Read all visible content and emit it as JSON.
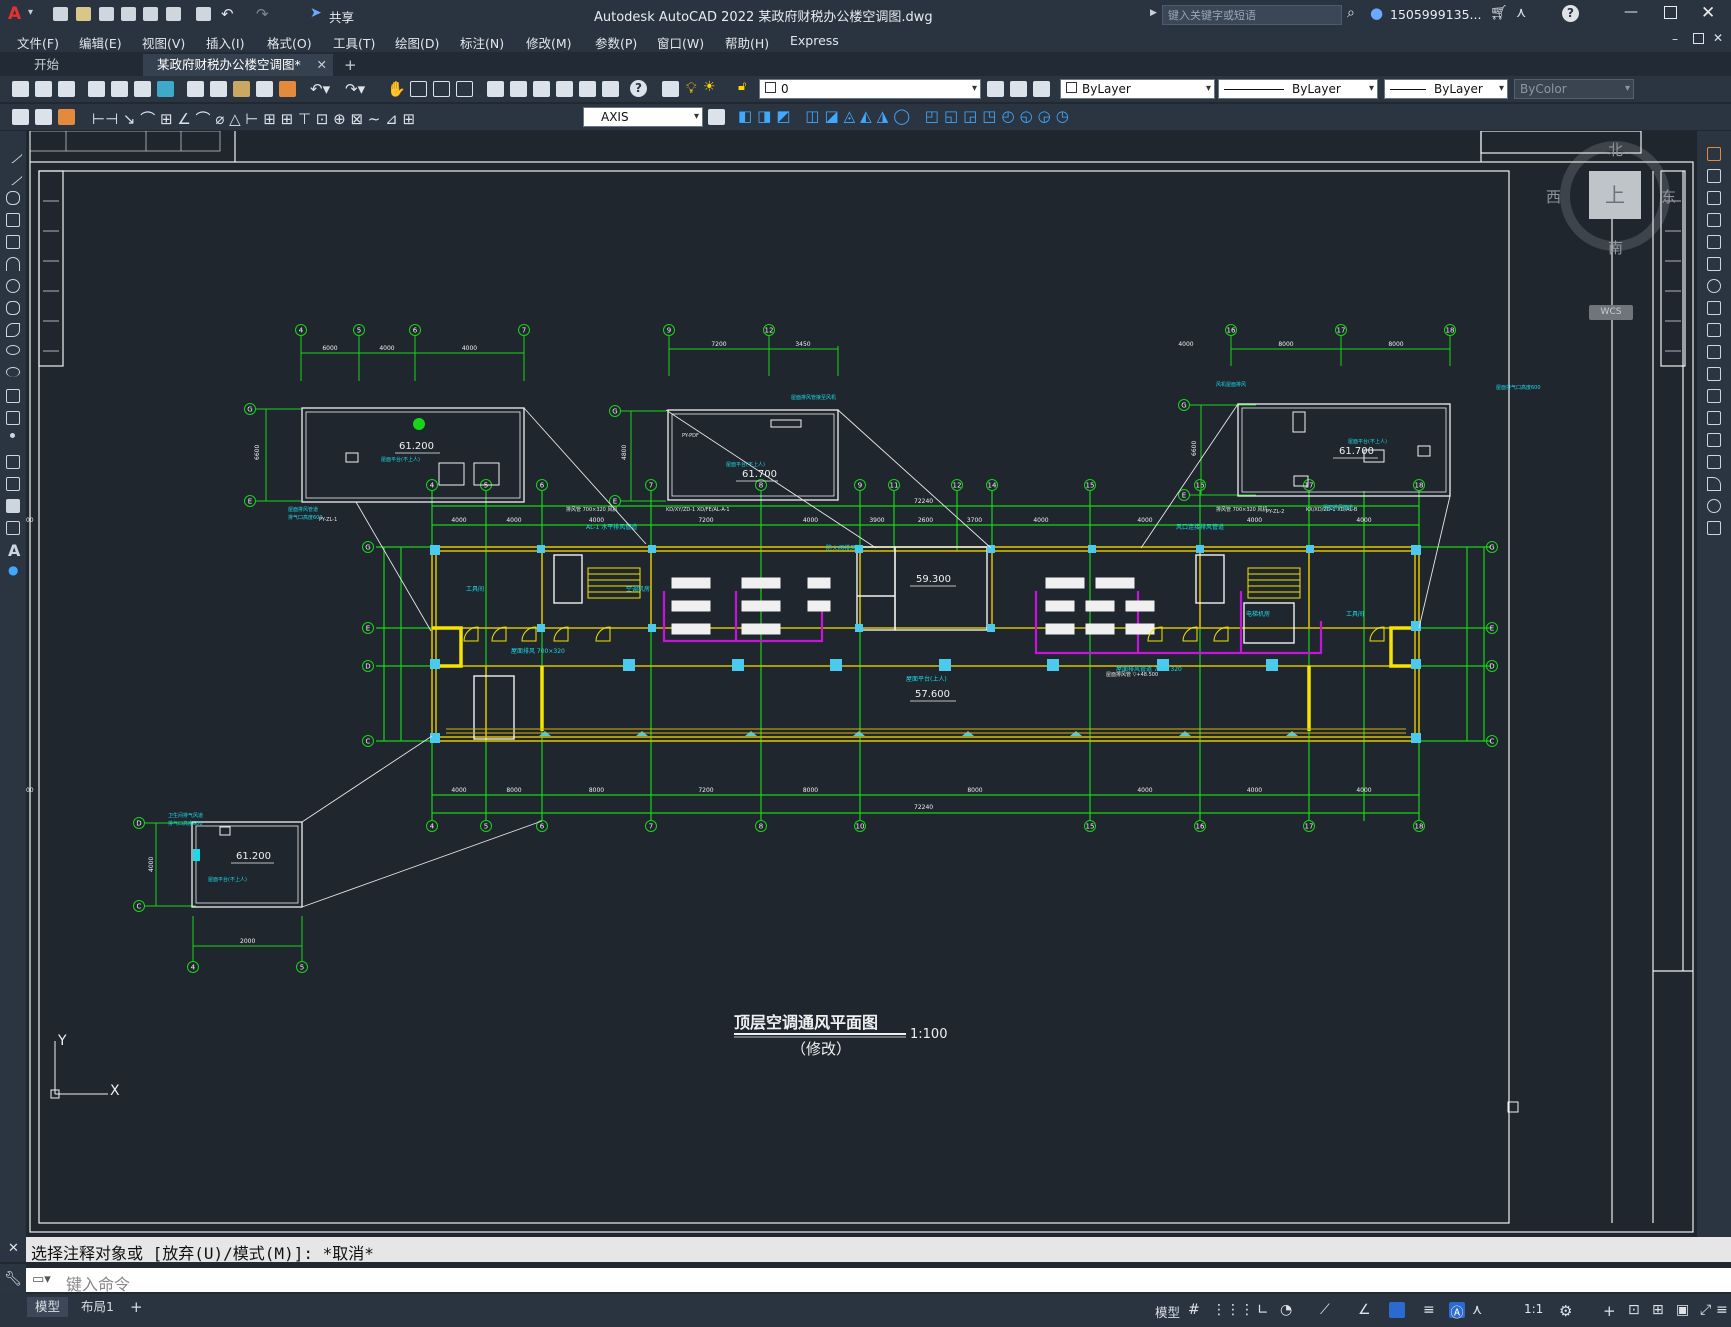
{
  "app": {
    "title": "Autodesk AutoCAD 2022    某政府财税办公楼空调图.dwg",
    "share_label": "共享",
    "search_placeholder": "键入关键字或短语",
    "user": "1505999135...",
    "logo": "A"
  },
  "menu": [
    "文件(F)",
    "编辑(E)",
    "视图(V)",
    "插入(I)",
    "格式(O)",
    "工具(T)",
    "绘图(D)",
    "标注(N)",
    "修改(M)",
    "参数(P)",
    "窗口(W)",
    "帮助(H)",
    "Express"
  ],
  "tabs": [
    {
      "label": "开始",
      "active": false
    },
    {
      "label": "某政府财税办公楼空调图*",
      "active": true
    }
  ],
  "toolbar1": {
    "layer": "0",
    "color": "ByLayer",
    "linetype": "ByLayer",
    "lineweight": "ByLayer",
    "plotstyle": "ByColor"
  },
  "toolbar2": {
    "dimstyle": "AXIS"
  },
  "viewcube": {
    "north": "北",
    "south": "南",
    "east": "东",
    "west": "西",
    "top": "上",
    "wcs": "WCS"
  },
  "drawing": {
    "title": "顶层空调通风平面图",
    "scale": "1:100",
    "subtitle": "（修改）",
    "elevations": {
      "roof_a": "61.200",
      "roof_b": "61.700",
      "roof_c": "61.700",
      "roof_d": "61.200",
      "stair": "59.300",
      "main": "57.600"
    },
    "top_axes": [
      "4",
      "5",
      "6",
      "7",
      "8",
      "9",
      "11",
      "12",
      "14",
      "15",
      "16",
      "17",
      "18"
    ],
    "bottom_axes": [
      "4",
      "5",
      "6",
      "7",
      "8",
      "10",
      "15",
      "16",
      "17",
      "18"
    ],
    "row_axes": [
      "G",
      "E",
      "D",
      "C"
    ],
    "dim_top": [
      "4000",
      "4000",
      "4000",
      "7200",
      "4000",
      "3900",
      "2600",
      "3700",
      "4000",
      "4000",
      "4000",
      "4000",
      "4000"
    ],
    "dim_bottom": [
      "4000",
      "8000",
      "8000",
      "7200",
      "8000",
      "8000",
      "4000",
      "4000",
      "4000",
      "4500"
    ],
    "total": "72240",
    "inset_a_axes": [
      "4",
      "5",
      "6",
      "7"
    ],
    "inset_a_dims": [
      "6000",
      "4000",
      "4000"
    ],
    "inset_b_axes": [
      "9",
      "12"
    ],
    "inset_b_dims": [
      "7200",
      "3450"
    ],
    "inset_c_axes": [
      "16",
      "17",
      "18"
    ],
    "inset_c_dims": [
      "4000",
      "8000",
      "8000"
    ],
    "inset_d_axes": [
      "4",
      "5"
    ],
    "inset_d_dim": "2000",
    "inset_a_dim_v": "6600",
    "inset_b_dim_v": "4800",
    "inset_c_dim_v": "6600",
    "inset_d_dim_v": "4000"
  },
  "command": {
    "history": "选择注释对象或 [放弃(U)/模式(M)]: *取消*",
    "placeholder": "键入命令"
  },
  "status": {
    "tabs": [
      {
        "label": "模型",
        "active": true
      },
      {
        "label": "布局1",
        "active": false
      }
    ],
    "model_label": "模型",
    "scale": "1:1"
  },
  "colors": {
    "canvas_bg": "#1f262e",
    "axis_green": "#18d418",
    "wall_yellow": "#e5cc00",
    "duct_magenta": "#c614d9",
    "cyan": "#1fd9e6",
    "ui_dark": "#2a3441"
  }
}
